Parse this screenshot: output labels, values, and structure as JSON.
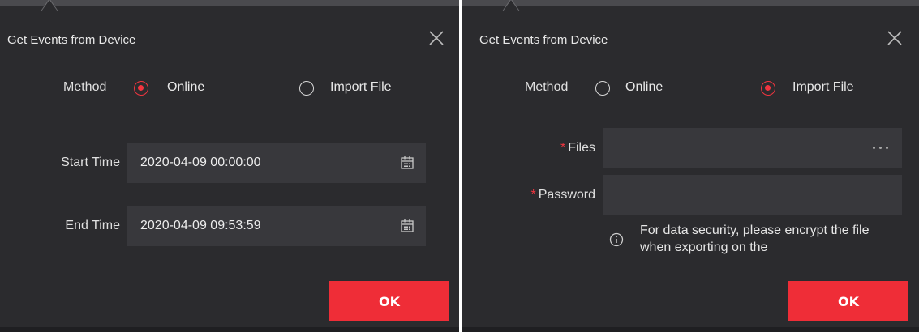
{
  "left_dialog": {
    "title": "Get Events from Device",
    "method_label": "Method",
    "options": [
      {
        "label": "Online",
        "selected": true
      },
      {
        "label": "Import File",
        "selected": false
      }
    ],
    "start_time_label": "Start Time",
    "start_time_value": "2020-04-09 00:00:00",
    "end_time_label": "End Time",
    "end_time_value": "2020-04-09 09:53:59",
    "ok_label": "OK"
  },
  "right_dialog": {
    "title": "Get Events from Device",
    "method_label": "Method",
    "options": [
      {
        "label": "Online",
        "selected": false
      },
      {
        "label": "Import File",
        "selected": true
      }
    ],
    "required_mark": "*",
    "files_label": "Files",
    "files_value": "",
    "password_label": "Password",
    "password_value": "",
    "info_text": "For data security, please encrypt the file when exporting on the",
    "ok_label": "OK"
  },
  "colors": {
    "panel_bg": "#2b2b2e",
    "field_bg": "#38383c",
    "accent_red": "#ef2d37",
    "text": "#e8e8e8"
  },
  "icons": {
    "close": "close-icon",
    "calendar": "calendar-icon",
    "more": "more-icon",
    "info": "info-icon"
  }
}
